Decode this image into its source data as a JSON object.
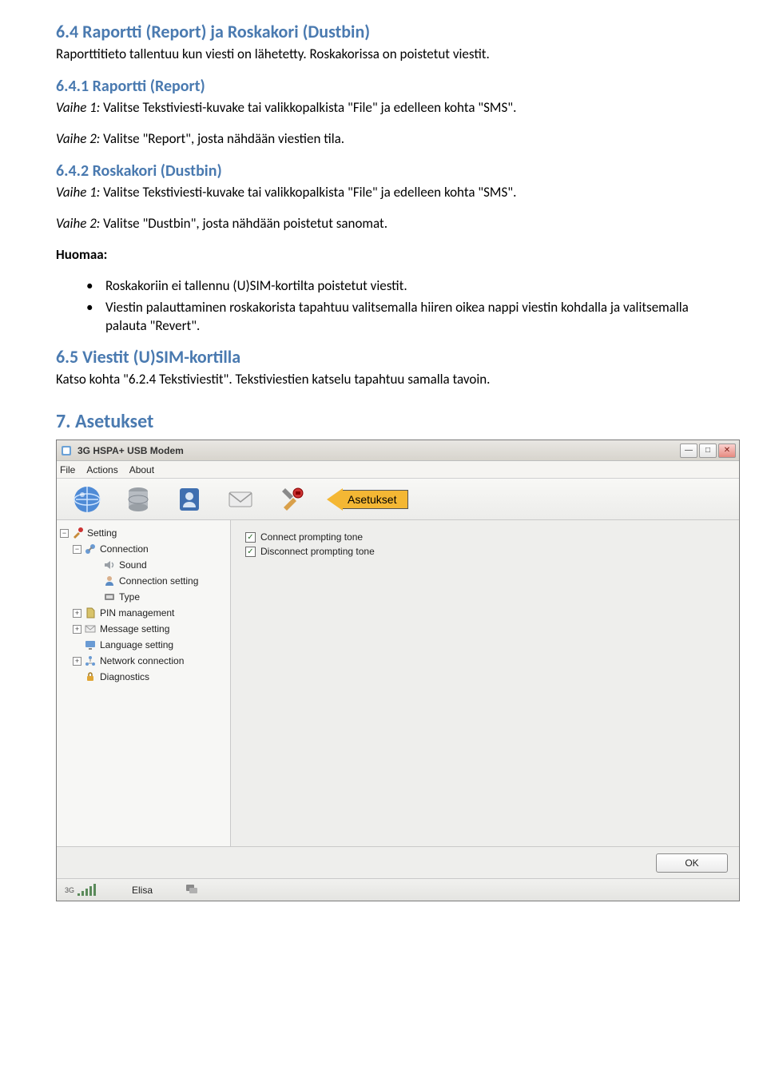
{
  "doc": {
    "h_6_4": "6.4 Raportti (Report) ja Roskakori (Dustbin)",
    "p_6_4": "Raporttitieto tallentuu kun viesti on lähetetty. Roskakorissa on poistetut viestit.",
    "h_6_4_1": "6.4.1 Raportti (Report)",
    "p_6_4_1_a_prefix": "Vaihe 1: ",
    "p_6_4_1_a": "Valitse Tekstiviesti-kuvake tai valikkopalkista \"File\" ja edelleen kohta \"SMS\".",
    "p_6_4_1_b_prefix": "Vaihe 2: ",
    "p_6_4_1_b": "Valitse \"Report\", josta nähdään viestien tila.",
    "h_6_4_2": "6.4.2 Roskakori (Dustbin)",
    "p_6_4_2_a_prefix": "Vaihe 1: ",
    "p_6_4_2_a": "Valitse Tekstiviesti-kuvake tai valikkopalkista \"File\" ja edelleen kohta \"SMS\".",
    "p_6_4_2_b_prefix": "Vaihe 2: ",
    "p_6_4_2_b": "Valitse \"Dustbin\", josta nähdään poistetut sanomat.",
    "huomaa": "Huomaa:",
    "bullet1": "Roskakoriin ei tallennu (U)SIM-kortilta poistetut viestit.",
    "bullet2": "Viestin palauttaminen roskakorista tapahtuu valitsemalla hiiren oikea nappi viestin kohdalla ja valitsemalla palauta \"Revert\".",
    "h_6_5": "6.5 Viestit (U)SIM-kortilla",
    "p_6_5": "Katso kohta \"6.2.4 Tekstiviestit\". Tekstiviestien katselu tapahtuu samalla tavoin.",
    "h_7": "7. Asetukset"
  },
  "app": {
    "title": "3G HSPA+ USB Modem",
    "menu": {
      "file": "File",
      "actions": "Actions",
      "about": "About"
    },
    "callout": "Asetukset",
    "tree": {
      "setting": "Setting",
      "connection": "Connection",
      "sound": "Sound",
      "connection_setting": "Connection setting",
      "type": "Type",
      "pin_management": "PIN management",
      "message_setting": "Message setting",
      "language_setting": "Language setting",
      "network_connection": "Network connection",
      "diagnostics": "Diagnostics"
    },
    "checkbox1": "Connect prompting tone",
    "checkbox2": "Disconnect prompting tone",
    "ok": "OK",
    "status": {
      "carrier": "Elisa",
      "signal_label": "3G"
    }
  }
}
